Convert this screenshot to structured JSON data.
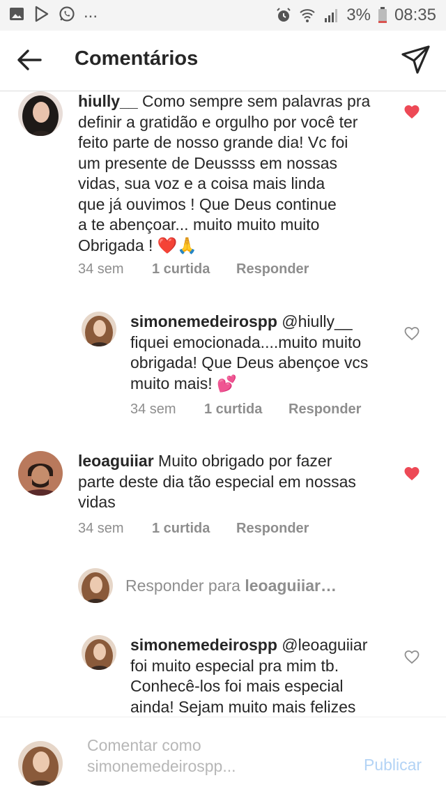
{
  "status_bar": {
    "left_icons": [
      "image-icon",
      "play-store-icon",
      "whatsapp-icon"
    ],
    "more": "...",
    "battery": "3%",
    "time": "08:35"
  },
  "header": {
    "title": "Comentários"
  },
  "comments": [
    {
      "username": "hiully__",
      "text_lines": [
        "Como sempre sem palavras pra",
        "definir a gratidão e orgulho por você ter",
        "feito parte de nosso grande dia! Vc foi",
        "um presente de Deussss em nossas",
        "vidas, sua voz e a coisa mais linda",
        "que já ouvimos ! Que Deus continue",
        "a te abençoar... muito muito muito",
        "Obrigada ! ❤️🙏"
      ],
      "time": "34 sem",
      "likes": "1 curtida",
      "reply": "Responder",
      "liked": true
    },
    {
      "username": "simonemedeirospp",
      "mention": "@hiully__",
      "text_lines": [
        "fiquei emocionada....muito muito",
        "obrigada! Que Deus abençoe vcs",
        "muito mais! 💕"
      ],
      "time": "34 sem",
      "likes": "1 curtida",
      "reply": "Responder",
      "liked": false
    },
    {
      "username": "leoaguiiar",
      "text_lines": [
        "Muito obrigado por fazer",
        "parte deste dia tão especial em nossas",
        "vidas"
      ],
      "time": "34 sem",
      "likes": "1 curtida",
      "reply": "Responder",
      "liked": true
    },
    {
      "username": "simonemedeirospp",
      "mention": "@leoaguiiar",
      "text_lines": [
        "foi muito especial pra mim tb.",
        "Conhecê-los foi mais especial",
        "ainda! Sejam muito mais felizes"
      ],
      "liked": false
    }
  ],
  "reply_prompt": {
    "prefix": "Responder para ",
    "username": "leoaguiiar…"
  },
  "footer": {
    "placeholder_line1": "Comentar como",
    "placeholder_line2": "simonemedeirospp...",
    "publish": "Publicar"
  },
  "colors": {
    "heart_liked": "#ed4956",
    "publish_disabled": "#b3d3f5",
    "meta_text": "#8e8e8e"
  }
}
